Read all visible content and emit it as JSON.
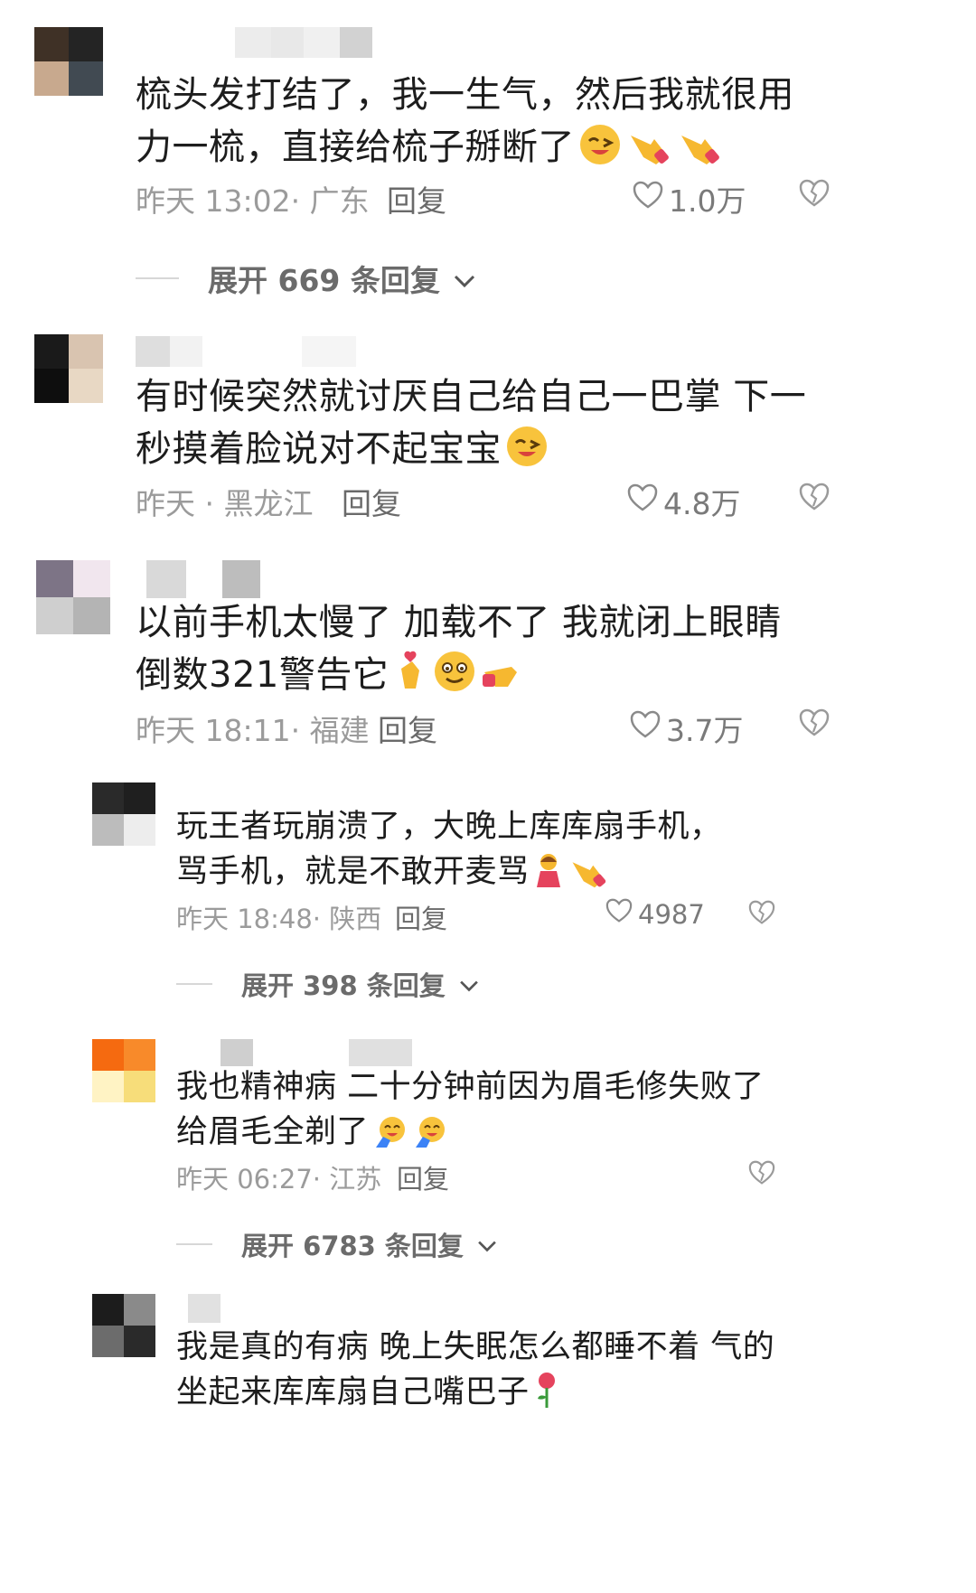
{
  "comments": [
    {
      "text": "梳头发打结了，我一生气，然后我就很用力一梳，直接给梳子掰断了",
      "time": "昨天 13:02· 广东",
      "reply_label": "回复",
      "likes": "1.0万",
      "expand": "展开 669 条回复",
      "emoji": [
        "wink-face-icon",
        "pointing-finger-icon",
        "pointing-finger-icon"
      ]
    },
    {
      "text": "有时候突然就讨厌自己给自己一巴掌 下一秒摸着脸说对不起宝宝",
      "time": "昨天 · 黑龙江",
      "reply_label": "回复",
      "likes": "4.8万",
      "emoji": [
        "wink-face-icon"
      ]
    },
    {
      "text": "以前手机太慢了 加载不了 我就闭上眼睛倒数321警告它",
      "time": "昨天 18:11· 福建",
      "reply_label": "回复",
      "likes": "3.7万",
      "emoji": [
        "finger-heart-icon",
        "smiling-face-icon",
        "pointing-finger-icon"
      ],
      "replies": [
        {
          "text": "玩王者玩崩溃了，大晚上库库扇手机，骂手机，就是不敢开麦骂",
          "time": "昨天 18:48· 陕西",
          "reply_label": "回复",
          "likes": "4987",
          "expand": "展开 398 条回复",
          "emoji": [
            "shy-person-icon",
            "pointing-finger-icon"
          ]
        },
        {
          "text": "我也精神病 二十分钟前因为眉毛修失败了 给眉毛全剃了",
          "time": "昨天 06:27· 江苏",
          "reply_label": "回复",
          "expand": "展开 6783 条回复",
          "emoji": [
            "crying-laugh-icon",
            "crying-laugh-icon"
          ]
        },
        {
          "text": "我是真的有病 晚上失眠怎么都睡不着 气的坐起来库库扇自己嘴巴子",
          "emoji": [
            "rose-icon"
          ]
        }
      ]
    }
  ],
  "colors": {
    "text": "#1d1d1d",
    "meta": "#9b9b9b",
    "accent_yellow": "#f6b830"
  }
}
